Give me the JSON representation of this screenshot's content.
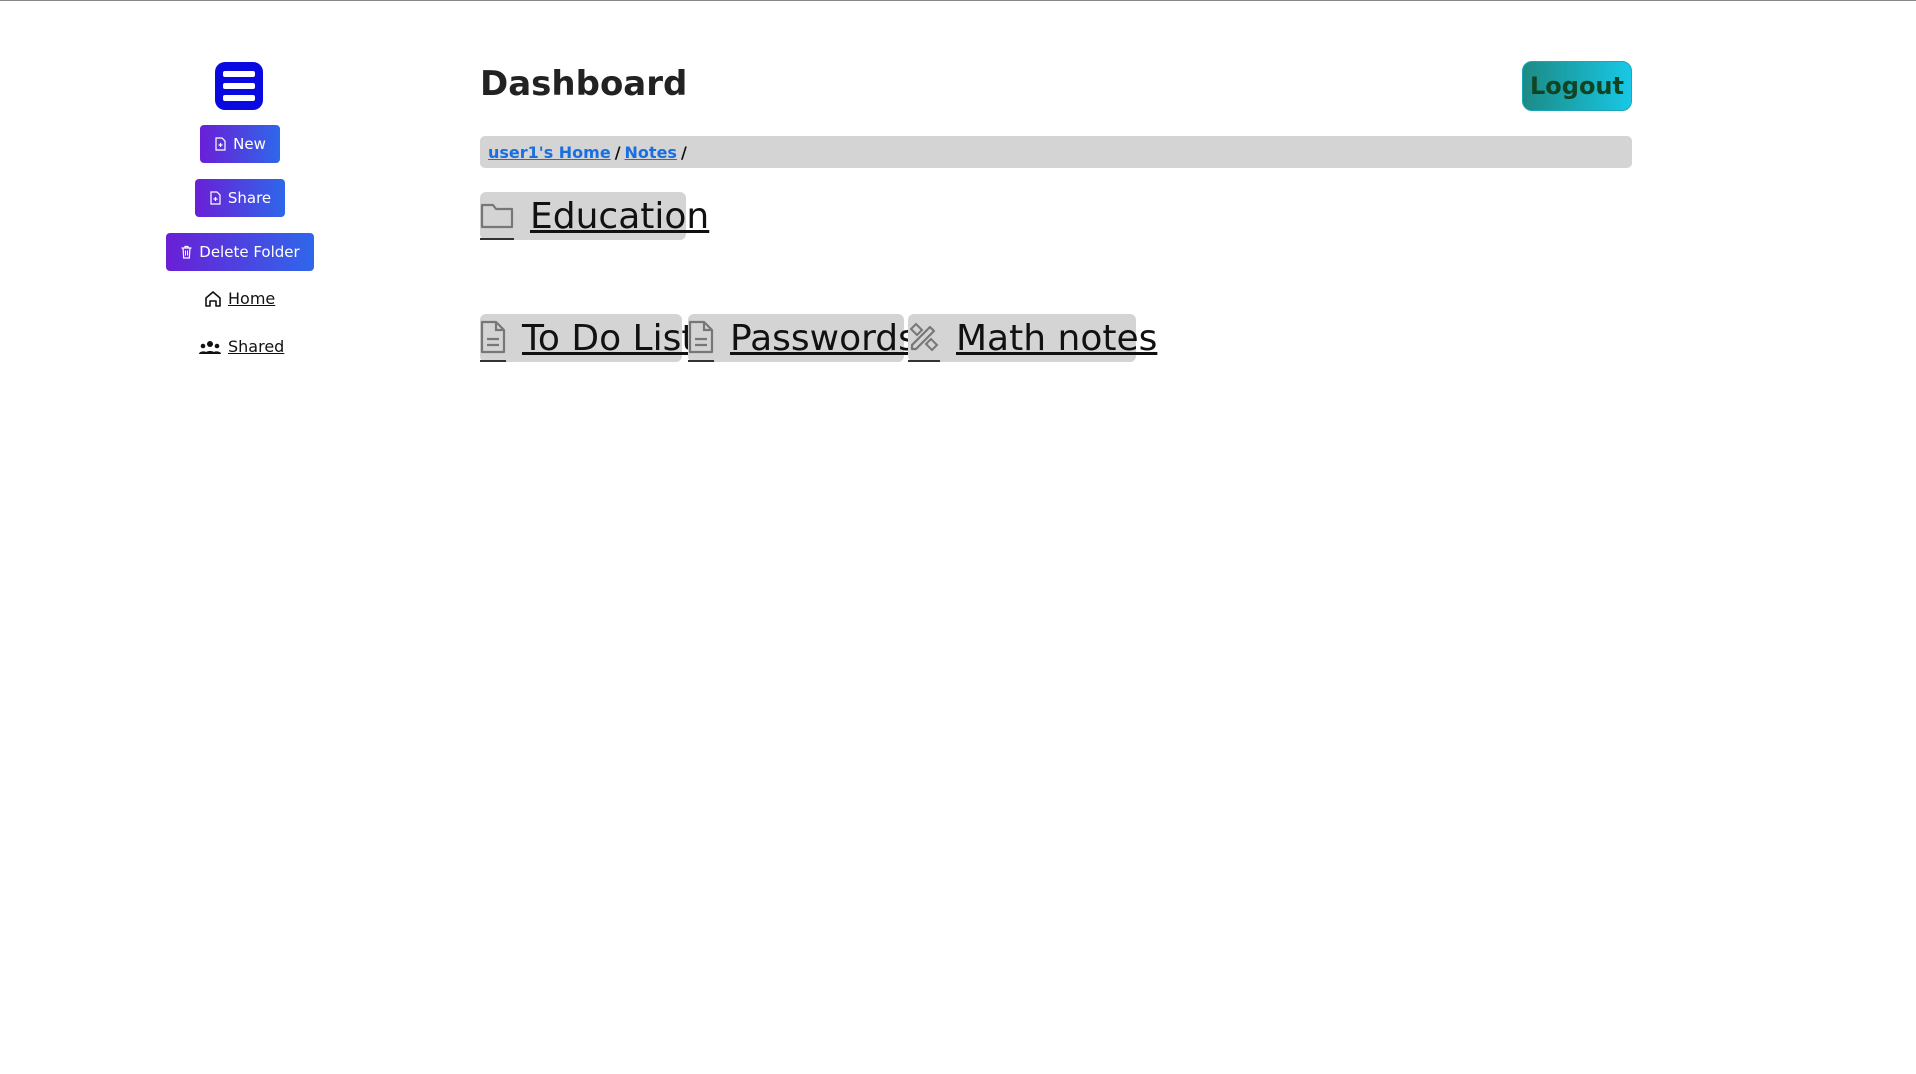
{
  "sidebar": {
    "new_label": "New",
    "share_label": "Share",
    "delete_label": "Delete Folder",
    "home_label": "Home",
    "shared_label": "Shared"
  },
  "header": {
    "title": "Dashboard",
    "logout_label": "Logout"
  },
  "breadcrumb": {
    "items": [
      "user1's Home",
      "Notes"
    ],
    "separator": "/"
  },
  "folders": [
    {
      "name": "Education",
      "icon": "folder-icon"
    }
  ],
  "files": [
    {
      "name": "To Do List",
      "icon": "document-icon"
    },
    {
      "name": "Passwords",
      "icon": "document-icon"
    },
    {
      "name": "Math notes",
      "icon": "pencil-ruler-icon"
    }
  ],
  "colors": {
    "logo": "#0a0ae0",
    "button_gradient_start": "#6a1fd6",
    "button_gradient_end": "#2f67ea",
    "logout_gradient_start": "#1c8a86",
    "logout_gradient_end": "#18c8e6",
    "link": "#1a6fe0",
    "tile_bg": "#d4d4d4"
  }
}
